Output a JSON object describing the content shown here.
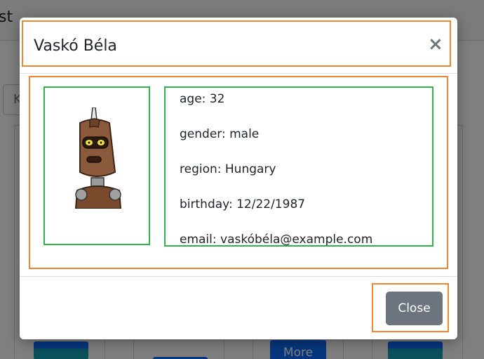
{
  "background": {
    "header_text": "st",
    "search_partial": "K",
    "more_button": "More"
  },
  "modal": {
    "title": "Vaskó Béla",
    "close_icon": "×",
    "avatar_icon": "robot-avatar",
    "fields": [
      {
        "label": "age",
        "value": "32",
        "text": "age: 32"
      },
      {
        "label": "gender",
        "value": "male",
        "text": "gender: male"
      },
      {
        "label": "region",
        "value": "Hungary",
        "text": "region: Hungary"
      },
      {
        "label": "birthday",
        "value": "12/22/1987",
        "text": "birthday: 12/22/1987"
      },
      {
        "label": "email",
        "value": "vaskóbéla@example.com",
        "text": "email: vaskóbéla@example.com"
      }
    ],
    "close_button": "Close"
  },
  "colors": {
    "highlight_orange": "#f0862e",
    "highlight_green": "#2fb34a",
    "close_button_bg": "#6c757d",
    "primary": "#0d6efd"
  }
}
